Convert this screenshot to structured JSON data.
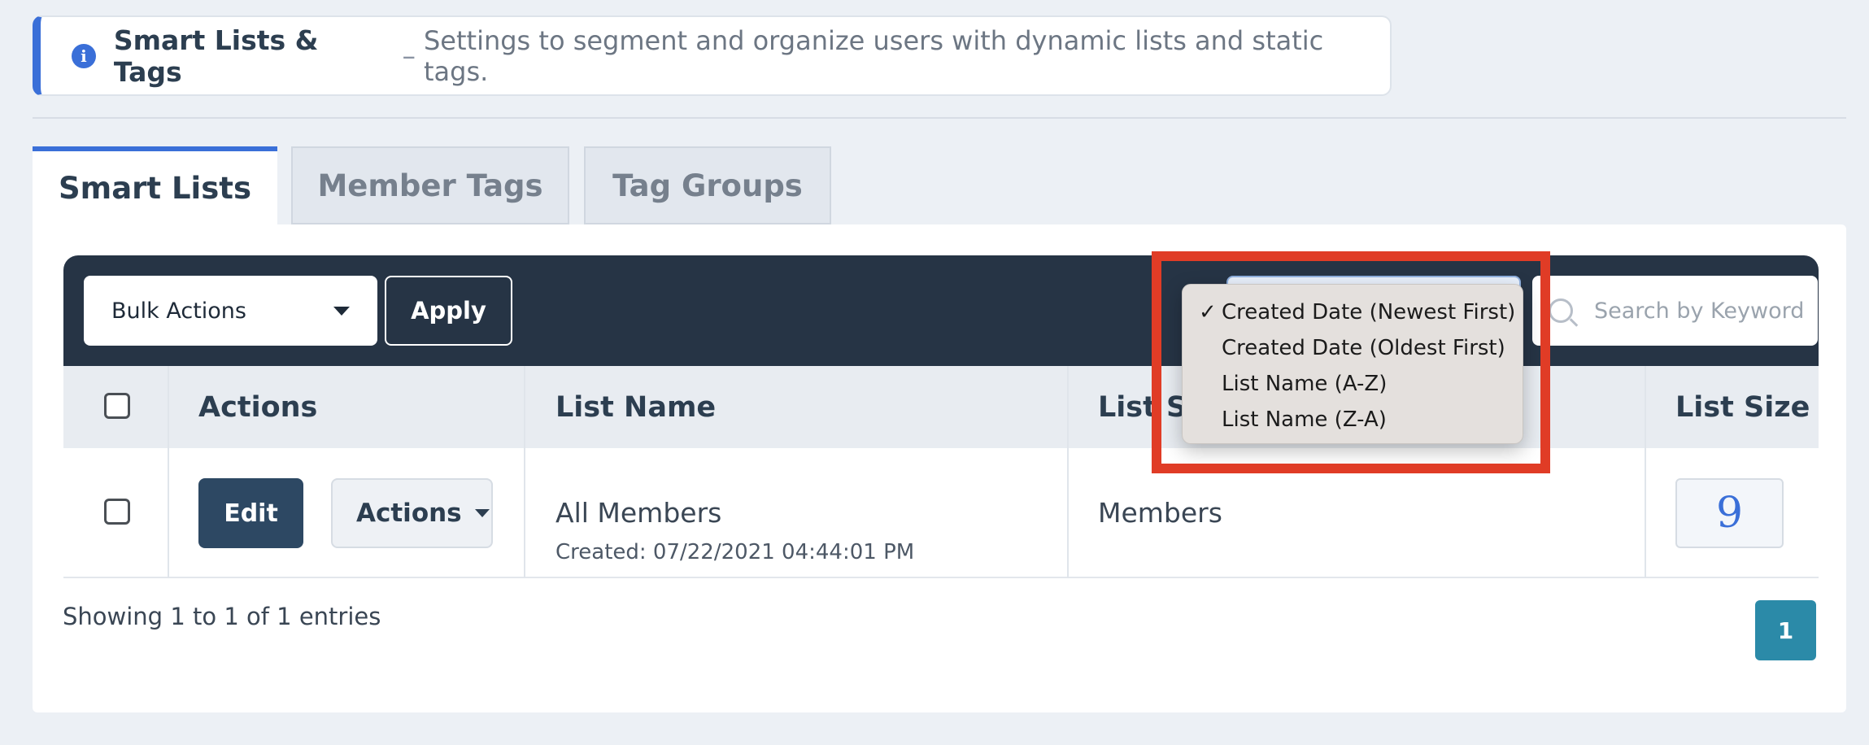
{
  "notice": {
    "title": "Smart Lists & Tags",
    "separator": "–",
    "description": "Settings to segment and organize users with dynamic lists and static tags."
  },
  "tabs": [
    {
      "label": "Smart Lists",
      "active": true
    },
    {
      "label": "Member Tags",
      "active": false
    },
    {
      "label": "Tag Groups",
      "active": false
    }
  ],
  "toolbar": {
    "bulk_actions_label": "Bulk Actions",
    "apply_label": "Apply",
    "search_placeholder": "Search by Keyword"
  },
  "sort_dropdown": {
    "options": [
      {
        "label": "Created Date (Newest First)",
        "checked": true
      },
      {
        "label": "Created Date (Oldest First)",
        "checked": false
      },
      {
        "label": "List Name (A-Z)",
        "checked": false
      },
      {
        "label": "List Name (Z-A)",
        "checked": false
      }
    ],
    "check_mark": "✓"
  },
  "table": {
    "columns": [
      "Actions",
      "List Name",
      "List So",
      "List Size"
    ],
    "rows": [
      {
        "edit_label": "Edit",
        "actions_label": "Actions",
        "list_name": "All Members",
        "created": "Created: 07/22/2021 04:44:01 PM",
        "list_source": "Members",
        "list_size": "9"
      }
    ]
  },
  "footer": {
    "entries_text": "Showing 1 to 1 of 1 entries",
    "current_page": "1"
  },
  "colors": {
    "accent": "#3a6fd8",
    "toolbar_bg": "#263445",
    "edit_button": "#2d4863",
    "pagination": "#2b8aa8",
    "highlight": "#e03c26"
  }
}
